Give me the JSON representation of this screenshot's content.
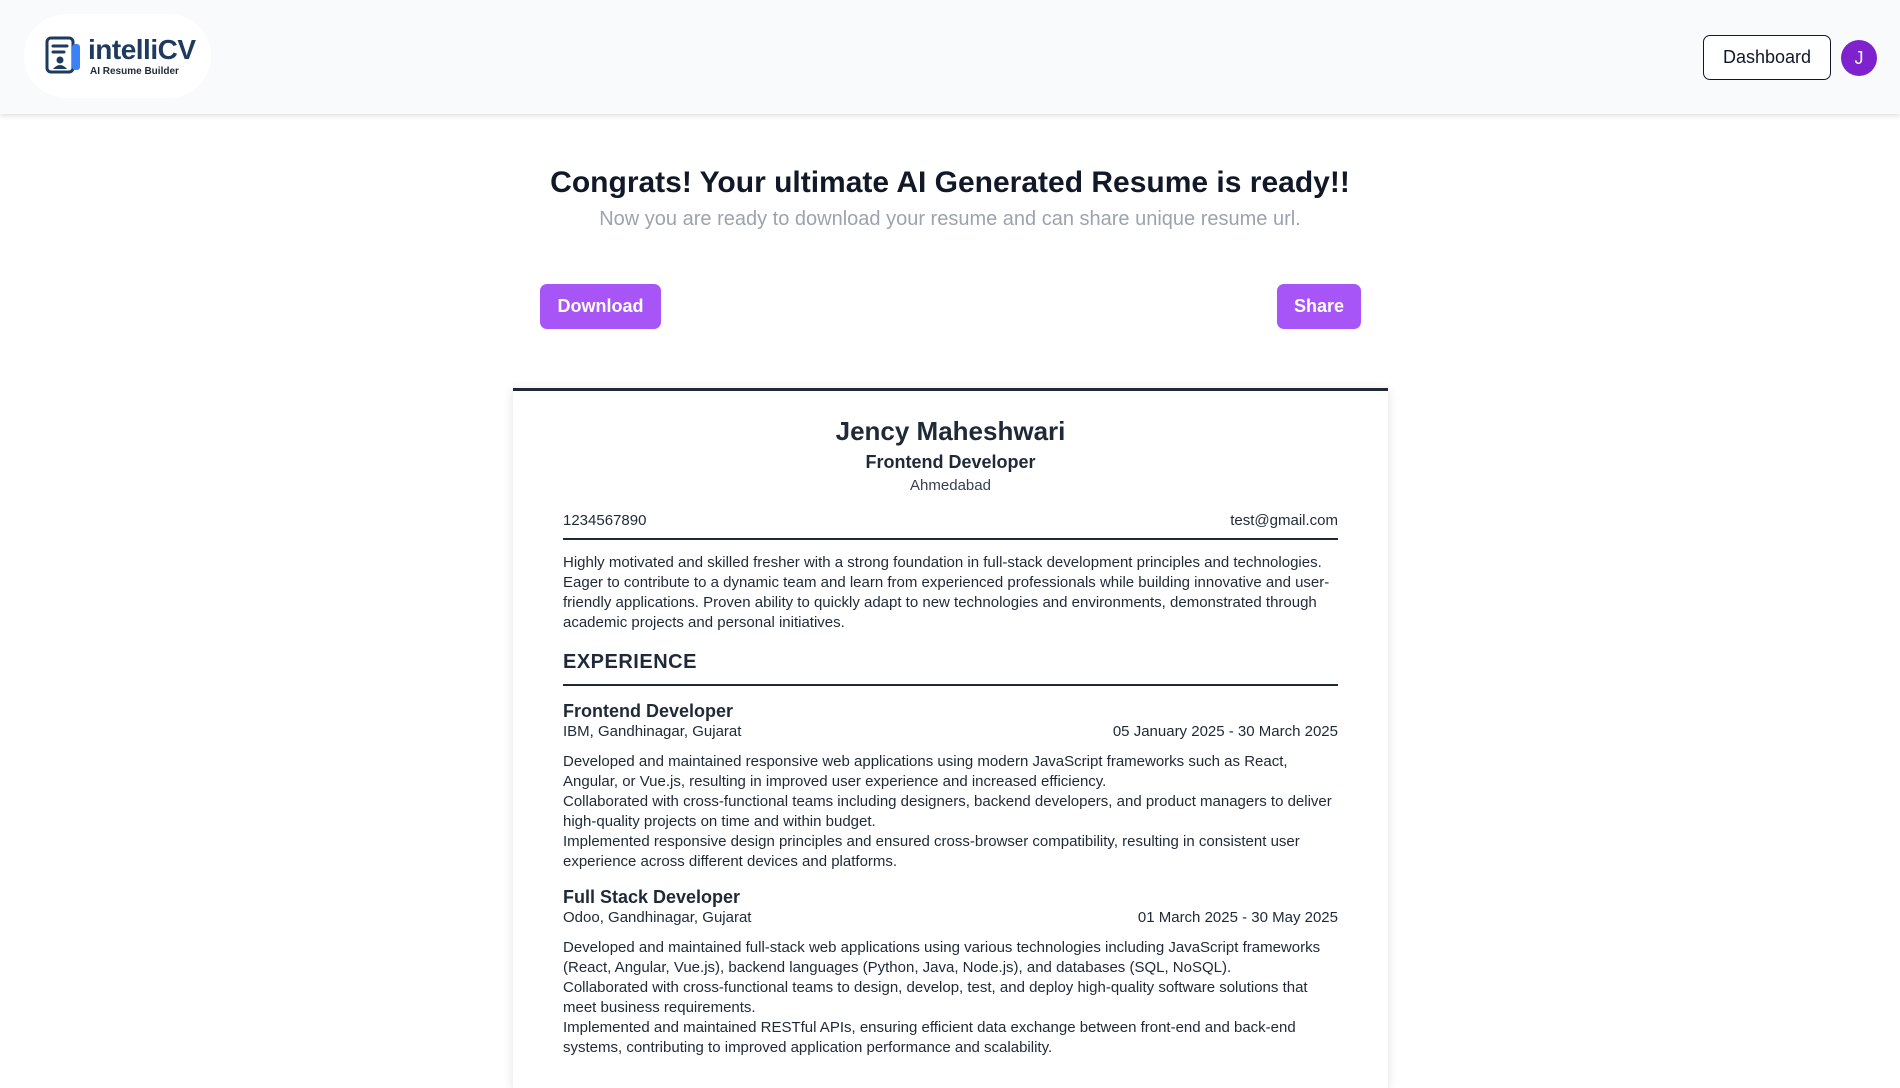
{
  "header": {
    "logo": {
      "name": "intelliCV",
      "tagline": "AI Resume Builder",
      "icon": "resume-document-icon"
    },
    "dashboard_label": "Dashboard",
    "avatar_initial": "J"
  },
  "hero": {
    "title": "Congrats! Your ultimate AI Generated Resume is ready!!",
    "subtitle": "Now you are ready to download your resume and can share unique resume url."
  },
  "actions": {
    "download_label": "Download",
    "share_label": "Share"
  },
  "resume": {
    "name": "Jency Maheshwari",
    "role": "Frontend Developer",
    "city": "Ahmedabad",
    "phone": "1234567890",
    "email": "test@gmail.com",
    "summary": "Highly motivated and skilled fresher with a strong foundation in full-stack development principles and technologies. Eager to contribute to a dynamic team and learn from experienced professionals while building innovative and user-friendly applications. Proven ability to quickly adapt to new technologies and environments, demonstrated through academic projects and personal initiatives.",
    "experience_heading": "EXPERIENCE",
    "experience": [
      {
        "title": "Frontend Developer",
        "company": "IBM, Gandhinagar, Gujarat",
        "dates": "05 January 2025 - 30 March 2025",
        "points": [
          "Developed and maintained responsive web applications using modern JavaScript frameworks such as React, Angular, or Vue.js, resulting in improved user experience and increased efficiency.",
          "Collaborated with cross-functional teams including designers, backend developers, and product managers to deliver high-quality projects on time and within budget.",
          "Implemented responsive design principles and ensured cross-browser compatibility, resulting in consistent user experience across different devices and platforms."
        ]
      },
      {
        "title": "Full Stack Developer",
        "company": "Odoo, Gandhinagar, Gujarat",
        "dates": "01 March 2025 - 30 May 2025",
        "points": [
          "Developed and maintained full-stack web applications using various technologies including JavaScript frameworks (React, Angular, Vue.js), backend languages (Python, Java, Node.js), and databases (SQL, NoSQL).",
          "Collaborated with cross-functional teams to design, develop, test, and deploy high-quality software solutions that meet business requirements.",
          "Implemented and maintained RESTful APIs, ensuring efficient data exchange between front-end and back-end systems, contributing to improved application performance and scalability."
        ]
      }
    ]
  },
  "colors": {
    "accent": "#a855f7",
    "avatar": "#7e22ce",
    "logo_text": "#1e3a5f",
    "subtitle": "#9ca3af"
  }
}
